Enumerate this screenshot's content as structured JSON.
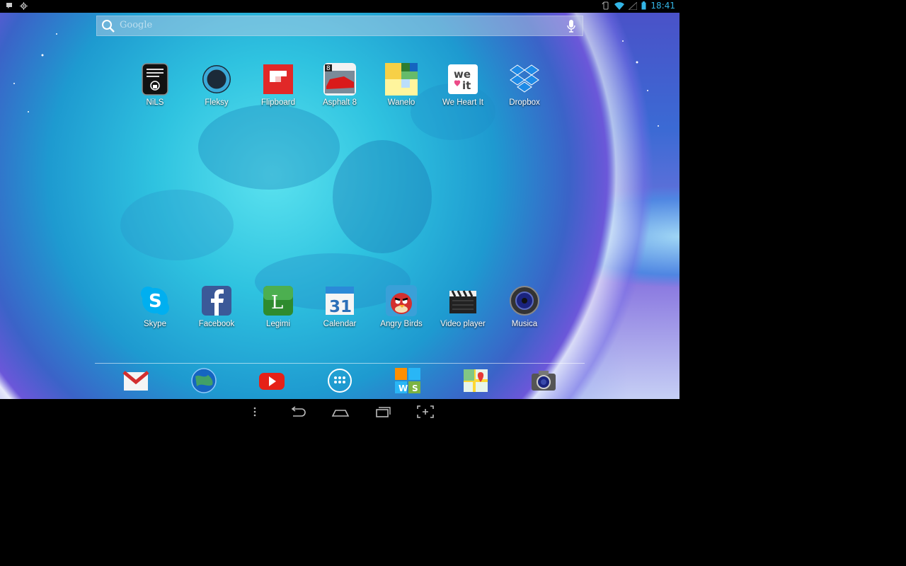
{
  "status_bar": {
    "time": "18:41",
    "left_icons": [
      "notification-icon",
      "location-icon"
    ],
    "right_icons": [
      "sync-icon",
      "wifi-icon",
      "signal-icon",
      "battery-icon"
    ]
  },
  "search": {
    "placeholder": "Google"
  },
  "apps_row1": [
    {
      "label": "NiLS",
      "icon": "nils-icon"
    },
    {
      "label": "Fleksy",
      "icon": "fleksy-icon"
    },
    {
      "label": "Flipboard",
      "icon": "flipboard-icon"
    },
    {
      "label": "Asphalt 8",
      "icon": "asphalt-icon"
    },
    {
      "label": "Wanelo",
      "icon": "wanelo-icon"
    },
    {
      "label": "We Heart It",
      "icon": "weheartit-icon"
    },
    {
      "label": "Dropbox",
      "icon": "dropbox-icon"
    }
  ],
  "apps_row2": [
    {
      "label": "Skype",
      "icon": "skype-icon"
    },
    {
      "label": "Facebook",
      "icon": "facebook-icon"
    },
    {
      "label": "Legimi",
      "icon": "legimi-icon"
    },
    {
      "label": "Calendar",
      "icon": "calendar-icon",
      "badge": "31"
    },
    {
      "label": "Angry Birds",
      "icon": "angry-birds-icon"
    },
    {
      "label": "Video player",
      "icon": "video-player-icon"
    },
    {
      "label": "Musica",
      "icon": "music-icon"
    }
  ],
  "dock": [
    "gmail-icon",
    "browser-icon",
    "youtube-icon",
    "all-apps-icon",
    "wordfeud-icon",
    "maps-icon",
    "camera-icon"
  ],
  "we_heart_it_text": "we\nit",
  "colors": {
    "accent": "#33b5e5",
    "flipboard": "#e12828",
    "skype": "#00aff0",
    "facebook": "#3b5998"
  }
}
